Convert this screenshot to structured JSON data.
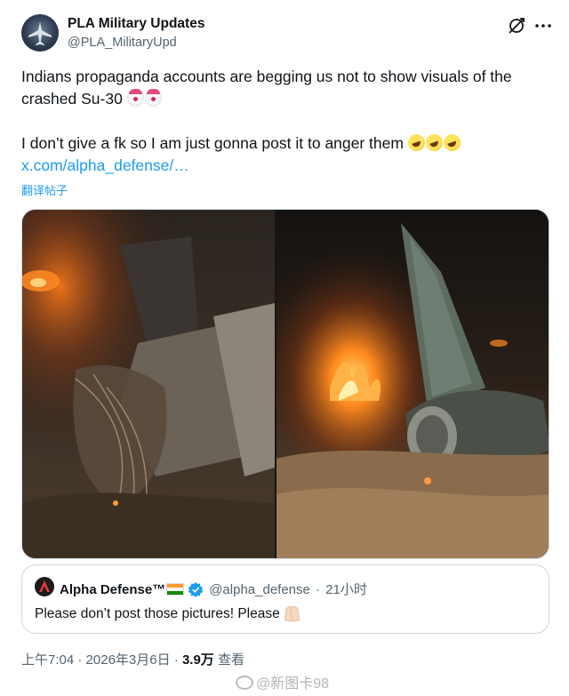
{
  "author": {
    "name": "PLA Military Updates",
    "handle": "@PLA_MilitaryUpd"
  },
  "tweet": {
    "line1": "Indians propaganda accounts are begging us not to show visuals of the crashed Su-30",
    "line2": "I don’t give a fk so I am just gonna post it to anger them",
    "link": "x.com/alpha_defense/…",
    "translate": "翻译帖子"
  },
  "icons": {
    "header": [
      "grok-icon",
      "more-icon"
    ],
    "emoji_line1": [
      "clown-face",
      "clown-face"
    ],
    "emoji_line2": [
      "rolling-on-floor-laughing",
      "rolling-on-floor-laughing",
      "rolling-on-floor-laughing"
    ]
  },
  "quote": {
    "name": "Alpha Defense™",
    "handle": "@alpha_defense",
    "separator": "·",
    "time": "21小时",
    "text": "Please don’t post those pictures! Please",
    "verified_color": "#1d9bf0"
  },
  "meta": {
    "time": "上午7:04",
    "sep1": "·",
    "date": "2026年3月6日",
    "sep2": "·",
    "views": "3.9万",
    "views_label": "查看"
  },
  "watermark": "@新图卡98",
  "colors": {
    "link": "#1d9bf0",
    "text": "#0f1419",
    "secondary": "#536471",
    "border": "#cfd9de"
  }
}
